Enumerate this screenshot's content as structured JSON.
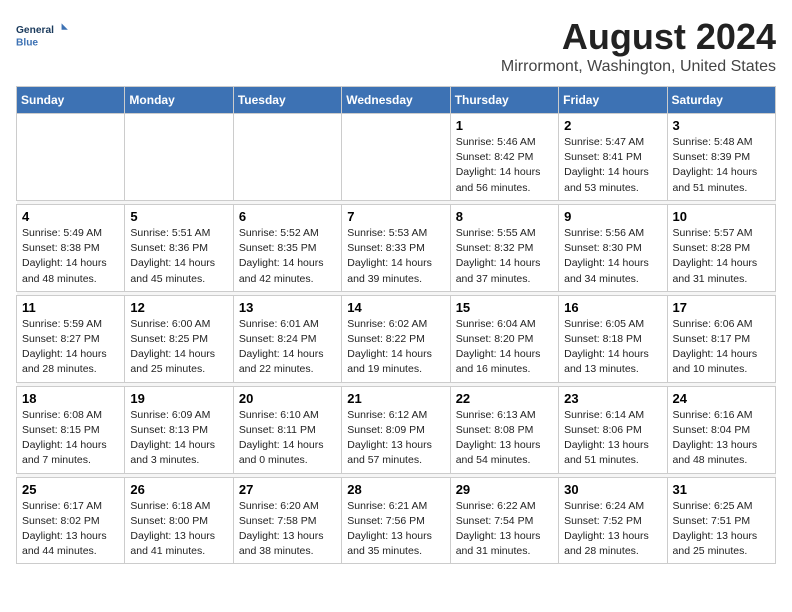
{
  "header": {
    "logo_line1": "General",
    "logo_line2": "Blue",
    "title": "August 2024",
    "subtitle": "Mirrormont, Washington, United States"
  },
  "weekdays": [
    "Sunday",
    "Monday",
    "Tuesday",
    "Wednesday",
    "Thursday",
    "Friday",
    "Saturday"
  ],
  "weeks": [
    [
      {
        "day": "",
        "info": ""
      },
      {
        "day": "",
        "info": ""
      },
      {
        "day": "",
        "info": ""
      },
      {
        "day": "",
        "info": ""
      },
      {
        "day": "1",
        "info": "Sunrise: 5:46 AM\nSunset: 8:42 PM\nDaylight: 14 hours\nand 56 minutes."
      },
      {
        "day": "2",
        "info": "Sunrise: 5:47 AM\nSunset: 8:41 PM\nDaylight: 14 hours\nand 53 minutes."
      },
      {
        "day": "3",
        "info": "Sunrise: 5:48 AM\nSunset: 8:39 PM\nDaylight: 14 hours\nand 51 minutes."
      }
    ],
    [
      {
        "day": "4",
        "info": "Sunrise: 5:49 AM\nSunset: 8:38 PM\nDaylight: 14 hours\nand 48 minutes."
      },
      {
        "day": "5",
        "info": "Sunrise: 5:51 AM\nSunset: 8:36 PM\nDaylight: 14 hours\nand 45 minutes."
      },
      {
        "day": "6",
        "info": "Sunrise: 5:52 AM\nSunset: 8:35 PM\nDaylight: 14 hours\nand 42 minutes."
      },
      {
        "day": "7",
        "info": "Sunrise: 5:53 AM\nSunset: 8:33 PM\nDaylight: 14 hours\nand 39 minutes."
      },
      {
        "day": "8",
        "info": "Sunrise: 5:55 AM\nSunset: 8:32 PM\nDaylight: 14 hours\nand 37 minutes."
      },
      {
        "day": "9",
        "info": "Sunrise: 5:56 AM\nSunset: 8:30 PM\nDaylight: 14 hours\nand 34 minutes."
      },
      {
        "day": "10",
        "info": "Sunrise: 5:57 AM\nSunset: 8:28 PM\nDaylight: 14 hours\nand 31 minutes."
      }
    ],
    [
      {
        "day": "11",
        "info": "Sunrise: 5:59 AM\nSunset: 8:27 PM\nDaylight: 14 hours\nand 28 minutes."
      },
      {
        "day": "12",
        "info": "Sunrise: 6:00 AM\nSunset: 8:25 PM\nDaylight: 14 hours\nand 25 minutes."
      },
      {
        "day": "13",
        "info": "Sunrise: 6:01 AM\nSunset: 8:24 PM\nDaylight: 14 hours\nand 22 minutes."
      },
      {
        "day": "14",
        "info": "Sunrise: 6:02 AM\nSunset: 8:22 PM\nDaylight: 14 hours\nand 19 minutes."
      },
      {
        "day": "15",
        "info": "Sunrise: 6:04 AM\nSunset: 8:20 PM\nDaylight: 14 hours\nand 16 minutes."
      },
      {
        "day": "16",
        "info": "Sunrise: 6:05 AM\nSunset: 8:18 PM\nDaylight: 14 hours\nand 13 minutes."
      },
      {
        "day": "17",
        "info": "Sunrise: 6:06 AM\nSunset: 8:17 PM\nDaylight: 14 hours\nand 10 minutes."
      }
    ],
    [
      {
        "day": "18",
        "info": "Sunrise: 6:08 AM\nSunset: 8:15 PM\nDaylight: 14 hours\nand 7 minutes."
      },
      {
        "day": "19",
        "info": "Sunrise: 6:09 AM\nSunset: 8:13 PM\nDaylight: 14 hours\nand 3 minutes."
      },
      {
        "day": "20",
        "info": "Sunrise: 6:10 AM\nSunset: 8:11 PM\nDaylight: 14 hours\nand 0 minutes."
      },
      {
        "day": "21",
        "info": "Sunrise: 6:12 AM\nSunset: 8:09 PM\nDaylight: 13 hours\nand 57 minutes."
      },
      {
        "day": "22",
        "info": "Sunrise: 6:13 AM\nSunset: 8:08 PM\nDaylight: 13 hours\nand 54 minutes."
      },
      {
        "day": "23",
        "info": "Sunrise: 6:14 AM\nSunset: 8:06 PM\nDaylight: 13 hours\nand 51 minutes."
      },
      {
        "day": "24",
        "info": "Sunrise: 6:16 AM\nSunset: 8:04 PM\nDaylight: 13 hours\nand 48 minutes."
      }
    ],
    [
      {
        "day": "25",
        "info": "Sunrise: 6:17 AM\nSunset: 8:02 PM\nDaylight: 13 hours\nand 44 minutes."
      },
      {
        "day": "26",
        "info": "Sunrise: 6:18 AM\nSunset: 8:00 PM\nDaylight: 13 hours\nand 41 minutes."
      },
      {
        "day": "27",
        "info": "Sunrise: 6:20 AM\nSunset: 7:58 PM\nDaylight: 13 hours\nand 38 minutes."
      },
      {
        "day": "28",
        "info": "Sunrise: 6:21 AM\nSunset: 7:56 PM\nDaylight: 13 hours\nand 35 minutes."
      },
      {
        "day": "29",
        "info": "Sunrise: 6:22 AM\nSunset: 7:54 PM\nDaylight: 13 hours\nand 31 minutes."
      },
      {
        "day": "30",
        "info": "Sunrise: 6:24 AM\nSunset: 7:52 PM\nDaylight: 13 hours\nand 28 minutes."
      },
      {
        "day": "31",
        "info": "Sunrise: 6:25 AM\nSunset: 7:51 PM\nDaylight: 13 hours\nand 25 minutes."
      }
    ]
  ]
}
